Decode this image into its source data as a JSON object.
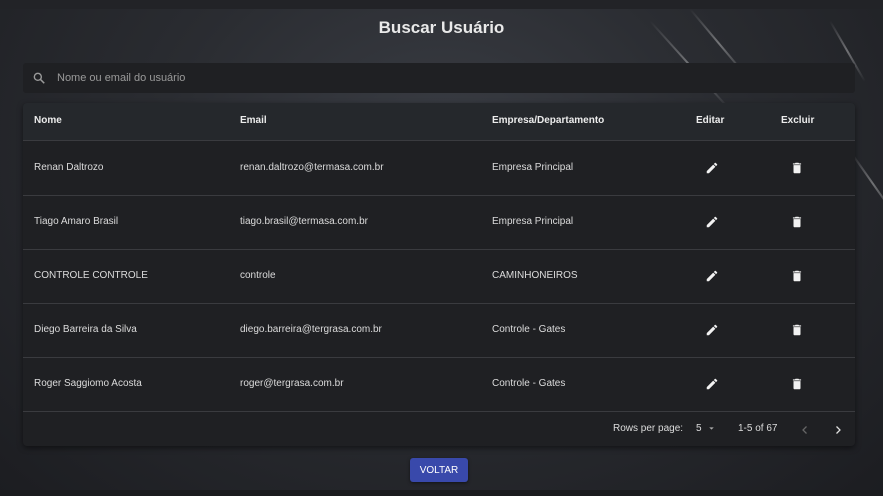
{
  "page": {
    "title": "Buscar Usuário"
  },
  "search": {
    "placeholder": "Nome ou email do usuário"
  },
  "table": {
    "headers": {
      "name": "Nome",
      "email": "Email",
      "company": "Empresa/Departamento",
      "edit": "Editar",
      "delete": "Excluir"
    },
    "rows": [
      {
        "name": "Renan Daltrozo",
        "email": "renan.daltrozo@termasa.com.br",
        "company": "Empresa Principal"
      },
      {
        "name": "Tiago Amaro Brasil",
        "email": "tiago.brasil@termasa.com.br",
        "company": "Empresa Principal"
      },
      {
        "name": "CONTROLE CONTROLE",
        "email": "controle",
        "company": "CAMINHONEIROS"
      },
      {
        "name": "Diego Barreira da Silva",
        "email": "diego.barreira@tergrasa.com.br",
        "company": "Controle - Gates"
      },
      {
        "name": "Roger Saggiomo Acosta",
        "email": "roger@tergrasa.com.br",
        "company": "Controle - Gates"
      }
    ]
  },
  "pagination": {
    "rows_per_page_label": "Rows per page:",
    "rows_per_page_value": "5",
    "range": "1-5 of 67"
  },
  "actions": {
    "back_label": "VOLTAR"
  },
  "icons": {
    "search": "search-icon",
    "edit": "pencil-icon",
    "delete": "trash-icon",
    "prev": "chevron-left-icon",
    "next": "chevron-right-icon",
    "dropdown": "caret-down-icon"
  },
  "colors": {
    "primary_button": "#3949ab",
    "surface": "#1f2023"
  }
}
